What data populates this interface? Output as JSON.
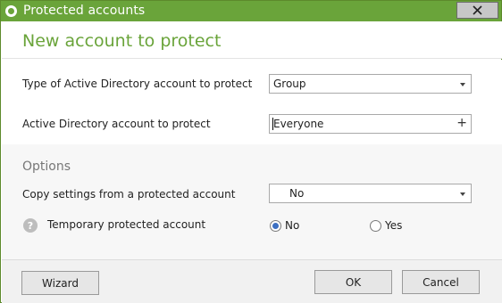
{
  "window": {
    "title": "Protected accounts",
    "close_icon": "close-icon"
  },
  "header": {
    "heading": "New account to protect"
  },
  "account_type": {
    "label": "Type of Active Directory account to protect",
    "value": "Group"
  },
  "account": {
    "label": "Active Directory account to protect",
    "value": "Everyone",
    "add_icon": "plus-icon"
  },
  "options": {
    "title": "Options",
    "copy_settings_label": "Copy settings from a protected account",
    "copy_settings_value": "No",
    "temporary_label": "Temporary protected account",
    "temporary_options": [
      {
        "label": "No",
        "selected": true
      },
      {
        "label": "Yes",
        "selected": false
      }
    ],
    "help_icon": "help-icon"
  },
  "footer": {
    "wizard_label": "Wizard",
    "ok_label": "OK",
    "cancel_label": "Cancel"
  },
  "colors": {
    "accent": "#6aa43a",
    "radio_selected": "#3c6fc2"
  }
}
